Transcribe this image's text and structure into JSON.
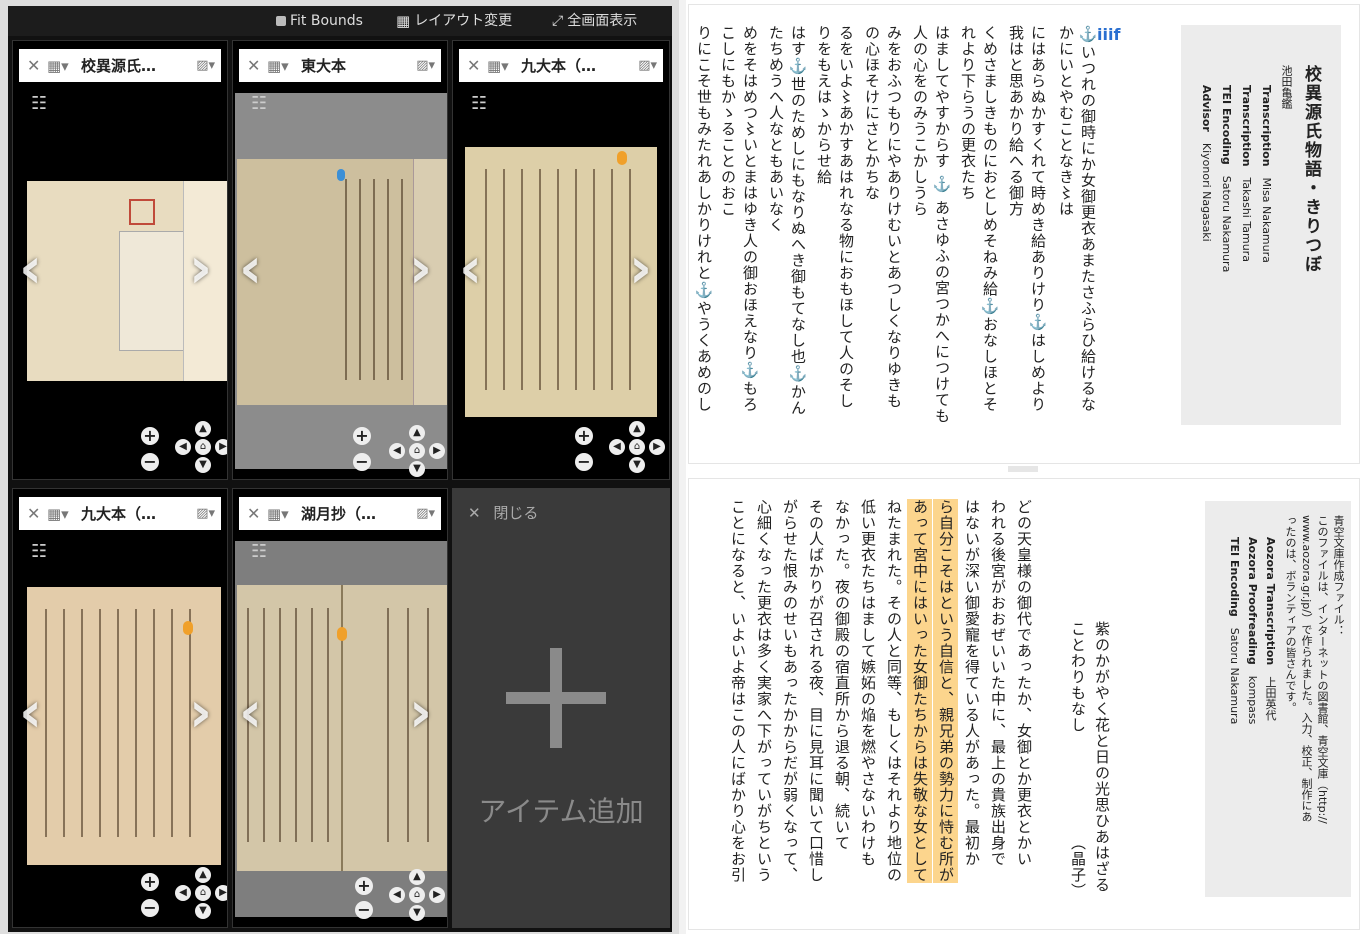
{
  "viewer": {
    "toolbar": {
      "fit_bounds": "Fit Bounds",
      "layout_change": "レイアウト変更",
      "fullscreen": "全画面表示"
    },
    "slots": [
      {
        "title": "校異源氏…"
      },
      {
        "title": "東大本"
      },
      {
        "title": "九大本（…"
      },
      {
        "title": "九大本（…"
      },
      {
        "title": "湖月抄（…"
      }
    ],
    "add_slot": {
      "close": "閉じる",
      "label": "アイテム追加"
    }
  },
  "pane1": {
    "credit": {
      "title": "校異源氏物語・きりつぼ",
      "author": "池田亀鑑",
      "rows": [
        {
          "role": "Transcription",
          "name": "Misa Nakamura"
        },
        {
          "role": "Transcription",
          "name": "Takashi Tamura"
        },
        {
          "role": "TEI Encoding",
          "name": "Satoru Nakamura"
        },
        {
          "role": "Advisor",
          "name": "Kiyonori Nagasaki"
        }
      ]
    },
    "logo": "iiif",
    "lines": [
      "⚓いつれの御時にか女御更衣あまたさふらひ給けるな",
      "かにいとやむことなき〻は",
      "にはあらぬかすくれて時めき給ありけり⚓はしめより",
      "我はと思あかり給へる御方",
      "くめさましきものにおとしめそねみ給⚓おなしほとそ",
      "れより下らうの更衣たち",
      "はましてやすからす ⚓ あさゆふの宮つかへにつけても",
      "人の心をのみうこかしうら",
      "みをおふつもりにやありけむいとあつしくなりゆきも",
      "の心ほそけにさとかちな",
      "るをいよ〻あかすあはれなる物におもほして人のそし",
      "りをもえはゝからせ給",
      "はす⚓世のためしにもなりぬへき御もてなし也⚓かん",
      "たちめうへ人なともあいなく",
      "めをそはめつ〻いとまはゆき人の御おほえなり⚓もろ",
      "こしにもかゝることのおこ",
      "りにこそ世もみたれあしかりけれと⚓やうくあめのし"
    ]
  },
  "pane2": {
    "credit": {
      "heading": "青空文庫作成ファイル：",
      "lines": [
        "このファイルは、インターネットの図書館、青空文庫（http://",
        "www.aozora.gr.jp/）で作られました。入力、校正、制作にあ",
        "ったのは、ボランティアの皆さんです。"
      ],
      "rows": [
        {
          "role": "Aozora Transcription",
          "name": "上田英代"
        },
        {
          "role": "Aozora Proofreading",
          "name": "kompass"
        },
        {
          "role": "TEI Encoding",
          "name": "Satoru Nakamura"
        }
      ]
    },
    "epigraph": "紫のかがやく花と日の光思ひあはざる",
    "epigraph2": "ことわりもなし",
    "epigraph_author": "（晶子）",
    "lines": [
      "どの天皇様の御代であったか、女御とか更衣とかい",
      "われる後宮がおおぜいいた中に、最上の貴族出身で",
      "はないが深い御愛寵を得ている人があった。最初か",
      "ら自分こそはという自信と、親兄弟の勢力に恃む所が",
      "あって宮中にはいった女御たちからは失敬な女として",
      "ねたまれた。その人と同等、もしくはそれより地位の",
      "低い更衣たちはまして嫉妬の焔を燃やさないわけも",
      "なかった。夜の御殿の宿直所から退る朝、続いて",
      "その人ばかりが召される夜、目に見耳に聞いて口惜し",
      "がらせた恨みのせいもあったかからだが弱くなって、",
      "心細くなった更衣は多く実家へ下がっていがちという",
      "ことになると、いよいよ帝はこの人にばかり心をお引"
    ]
  },
  "colors": {
    "highlight": "#fcd58d",
    "anchor": "#3470c0",
    "viewer_bg": "#111111"
  }
}
